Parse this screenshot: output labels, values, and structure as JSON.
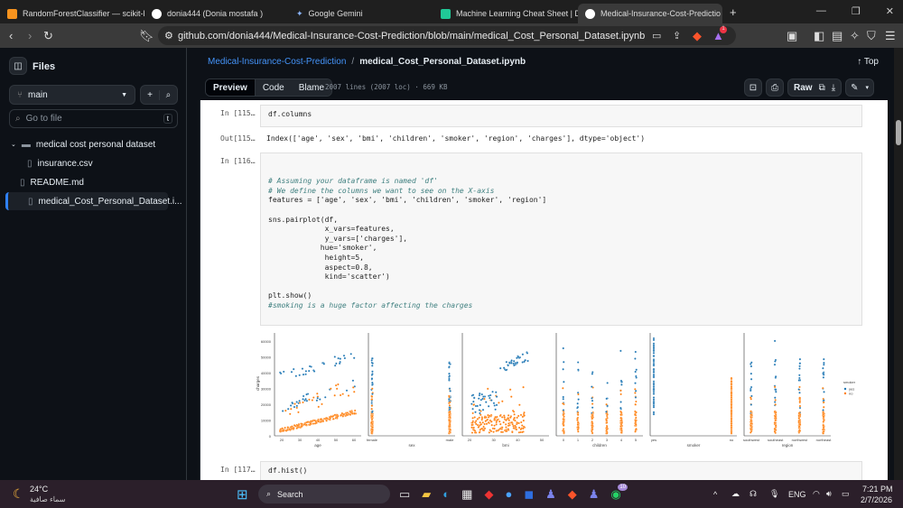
{
  "browser": {
    "tabs": [
      {
        "title": "RandomForestClassifier — scikit-lear",
        "color": "#f7931e"
      },
      {
        "title": "donia444 (Donia mostafa )",
        "color": "#ffffff"
      },
      {
        "title": "Google Gemini",
        "color": "#8ab4f8"
      },
      {
        "title": "Machine Learning Cheat Sheet | Data",
        "color": "#20c997"
      },
      {
        "title": "Medical-Insurance-Cost-Predictio",
        "color": "#ffffff"
      }
    ],
    "url": "github.com/donia444/Medical-Insurance-Cost-Prediction/blob/main/medical_Cost_Personal_Dataset.ipynb",
    "brave_badge": "1"
  },
  "sidebar": {
    "title": "Files",
    "branch": "main",
    "search_placeholder": "Go to file",
    "search_shortcut": "t",
    "tree": [
      {
        "label": "medical cost personal dataset",
        "type": "folder"
      },
      {
        "label": "insurance.csv",
        "type": "file"
      },
      {
        "label": "README.md",
        "type": "file"
      },
      {
        "label": "medical_Cost_Personal_Dataset.i...",
        "type": "file"
      }
    ]
  },
  "file": {
    "repo": "Medical-Insurance-Cost-Prediction",
    "sep": "/",
    "name": "medical_Cost_Personal_Dataset.ipynb",
    "top": "Top",
    "tabs": [
      "Preview",
      "Code",
      "Blame"
    ],
    "meta": "2007 lines (2007 loc) · 669 KB",
    "raw": "Raw"
  },
  "notebook": {
    "c115_in": "In [115…",
    "c115_code": "df.columns",
    "c115_out_label": "Out[115…",
    "c115_out": "Index(['age', 'sex', 'bmi', 'children', 'smoker', 'region', 'charges'], dtype='object')",
    "c116_in": "In [116…",
    "c116_lines": [
      "",
      "",
      "# Assuming your dataframe is named 'df'",
      "# We define the columns we want to see on the X-axis",
      "features = ['age', 'sex', 'bmi', 'children', 'smoker', 'region']",
      "",
      "sns.pairplot(df,",
      "             x_vars=features,",
      "             y_vars=['charges'],",
      "            hue='smoker',",
      "             height=5,",
      "             aspect=0.8,",
      "             kind='scatter')",
      "",
      "plt.show()",
      "#smoking is a huge factor affecting the charges"
    ],
    "c117_in": "In [117…",
    "c117_code": "df.hist()"
  },
  "chart_data": {
    "type": "scatter",
    "ylabel": "charges",
    "ylim": [
      0,
      65000
    ],
    "yticks": [
      "0",
      "10000",
      "20000",
      "30000",
      "40000",
      "50000",
      "60000"
    ],
    "panels": [
      {
        "xlabel": "age",
        "ticks": [
          "20",
          "30",
          "40",
          "50",
          "60"
        ]
      },
      {
        "xlabel": "sex",
        "ticks": [
          "female",
          "male"
        ]
      },
      {
        "xlabel": "bmi",
        "ticks": [
          "20",
          "30",
          "40",
          "50"
        ]
      },
      {
        "xlabel": "children",
        "ticks": [
          "0",
          "1",
          "2",
          "3",
          "4",
          "5"
        ]
      },
      {
        "xlabel": "smoker",
        "ticks": [
          "yes",
          "no"
        ]
      },
      {
        "xlabel": "region",
        "ticks": [
          "southwest",
          "southeast",
          "northwest",
          "northeast"
        ]
      }
    ],
    "legend": {
      "title": "smoker",
      "placement": "right",
      "entries": [
        {
          "label": "yes",
          "color": "#1f77b4"
        },
        {
          "label": "no",
          "color": "#ff7f0e"
        }
      ]
    }
  },
  "taskbar": {
    "temp": "24°C",
    "weather": "سماء صافية",
    "search": "Search",
    "lang": "ENG",
    "time": "7:21 PM",
    "date": "2/7/2026",
    "badge": "10"
  }
}
